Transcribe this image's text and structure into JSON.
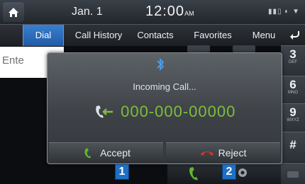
{
  "status_bar": {
    "date": "Jan.  1",
    "time": "12:00",
    "ampm": "AM",
    "status_icons": "▮▮▯ ◐ ▼"
  },
  "tabs": [
    {
      "label": "Dial",
      "active": true
    },
    {
      "label": "Call History"
    },
    {
      "label": "Contacts"
    },
    {
      "label": "Favorites"
    }
  ],
  "menu_label": "Menu",
  "entry": {
    "placeholder": "Ente"
  },
  "keypad": [
    {
      "num": "3",
      "sub": "DEF"
    },
    {
      "num": "6",
      "sub": "MNO"
    },
    {
      "num": "9",
      "sub": "WXYZ"
    },
    {
      "num": "#",
      "sub": ""
    }
  ],
  "popup": {
    "title": "Incoming Call...",
    "number": "000-000-00000",
    "accept_label": "Accept",
    "reject_label": "Reject"
  },
  "callouts": [
    "1",
    "2"
  ],
  "colors": {
    "accent_blue": "#2a6fc4",
    "number_green": "#7dbf3a",
    "reject_red": "#e0312b",
    "accept_green": "#5fb82e"
  }
}
